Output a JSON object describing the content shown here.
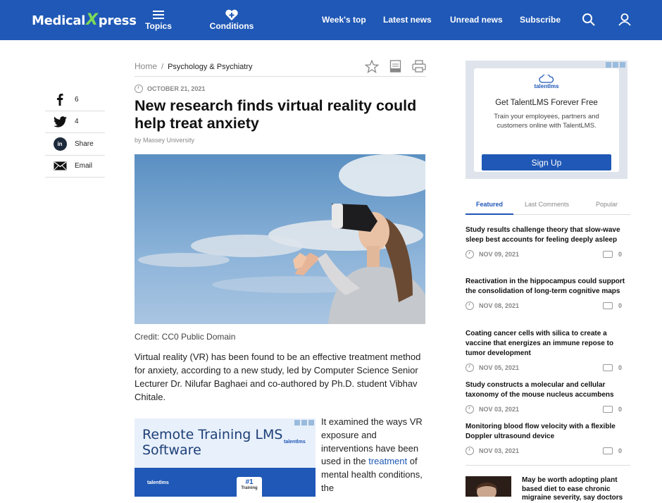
{
  "header": {
    "logo_left": "Medical",
    "logo_x": "X",
    "logo_right": "press",
    "nav": [
      "Topics",
      "Conditions"
    ],
    "links": [
      "Week's top",
      "Latest news",
      "Unread news",
      "Subscribe"
    ],
    "icons": [
      "menu-icon",
      "heart-plus-icon",
      "search-icon",
      "user-icon"
    ],
    "bg_color": "#1f58b6"
  },
  "share": [
    {
      "icon": "facebook-icon",
      "label": "6"
    },
    {
      "icon": "twitter-icon",
      "label": "4"
    },
    {
      "icon": "linkedin-icon",
      "label": "Share",
      "glyph": "in"
    },
    {
      "icon": "email-icon",
      "label": "Email"
    }
  ],
  "article": {
    "breadcrumb_home": "Home",
    "breadcrumb_sep": "/",
    "breadcrumb_category": "Psychology & Psychiatry",
    "date": "OCTOBER 21, 2021",
    "title": "New research finds virtual reality could help treat anxiety",
    "byline": "by Massey University",
    "credit": "Credit: CC0 Public Domain",
    "lead": "Virtual reality (VR) has been found to be an effective treatment method for anxiety, according to a new study, led by Computer Science Senior Lecturer Dr. Nilufar Baghaei and co-authored by Ph.D. student Vibhav Chitale.",
    "body_before": "It examined the ways VR exposure and interventions have been used in the ",
    "body_link": "treatment",
    "body_after": " of mental health conditions, the"
  },
  "inline_ad": {
    "title": "Remote Training LMS Software",
    "brand": "talentlms",
    "badge": "#1",
    "badge_sub": "Training"
  },
  "side_ad": {
    "brand": "talentlms",
    "title": "Get TalentLMS Forever Free",
    "text": "Train your employees, partners and customers online with TalentLMS.",
    "button": "Sign Up"
  },
  "tabs": [
    "Featured",
    "Last Comments",
    "Popular"
  ],
  "news": [
    {
      "title": "Study results challenge theory that slow-wave sleep best accounts for feeling deeply asleep",
      "date": "NOV 09, 2021",
      "comments": "0"
    },
    {
      "title": "Reactivation in the hippocampus could support the consolidation of long-term cognitive maps",
      "date": "NOV 08, 2021",
      "comments": "0"
    },
    {
      "title": "Coating cancer cells with silica to create a vaccine that energizes an immune repose to tumor development",
      "date": "NOV 05, 2021",
      "comments": "0"
    },
    {
      "title": "Study constructs a molecular and cellular taxonomy of the mouse nucleus accumbens",
      "date": "NOV 03, 2021",
      "comments": "0"
    },
    {
      "title": "Monitoring blood flow velocity with a flexible Doppler ultrasound device",
      "date": "NOV 03, 2021",
      "comments": "0"
    }
  ],
  "next_story": "May be worth adopting plant based diet to ease chronic migraine severity, say doctors"
}
